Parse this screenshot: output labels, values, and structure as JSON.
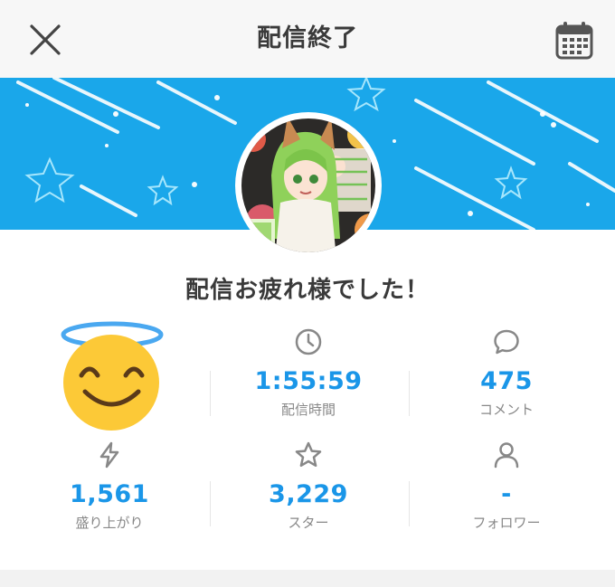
{
  "header": {
    "title": "配信終了",
    "close_icon": "close-icon",
    "calendar_icon": "calendar-icon"
  },
  "banner": {
    "background_color": "#1aa7ea",
    "avatar_icon": "stream-avatar-image"
  },
  "message": "配信お疲れ様でした！",
  "stats": {
    "duration": {
      "icon": "clock-icon",
      "value": "1:55:59",
      "label": "配信時間"
    },
    "comments": {
      "icon": "speech-bubble-icon",
      "value": "475",
      "label": "コメント"
    },
    "hype": {
      "icon": "lightning-icon",
      "value": "1,561",
      "label": "盛り上がり"
    },
    "stars": {
      "icon": "star-icon",
      "value": "3,229",
      "label": "スター"
    },
    "followers": {
      "icon": "person-icon",
      "value": "-",
      "label": "フォロワー"
    }
  },
  "emoji": "smiling-face-with-halo-emoji",
  "colors": {
    "accent": "#1a96e8",
    "banner": "#1aa7ea",
    "label": "#888888",
    "header_bg": "#f7f7f7"
  }
}
